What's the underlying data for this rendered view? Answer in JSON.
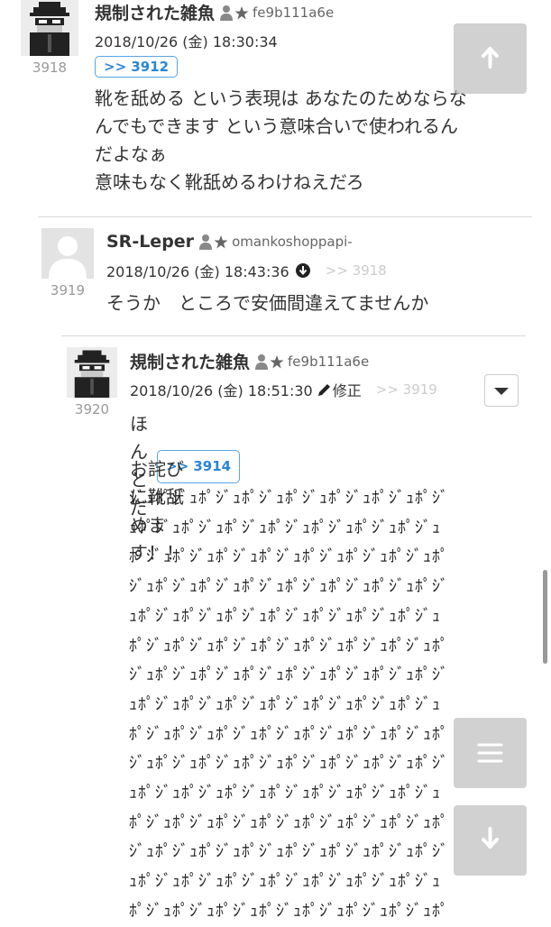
{
  "posts": [
    {
      "number": "3918",
      "name": "規制された雑魚",
      "uid": "fe9b111a6e",
      "date": "2018/10/26 (金) 18:30:34",
      "anchor": ">> 3912",
      "body": "靴を舐める という表現は あなたのためならな\nんでもできます という意味合いで使われるん\nだよなぁ\n意味もなく靴舐めるわけねえだろ"
    },
    {
      "number": "3919",
      "name": "SR-Leper",
      "uid": "omankoshoppapi-",
      "date": "2018/10/26 (金) 18:43:36",
      "reply_ref": ">> 3918",
      "body": "そうか　ところで安価間違えてませんか"
    },
    {
      "number": "3920",
      "name": "規制された雑魚",
      "uid": "fe9b111a6e",
      "date": "2018/10/26 (金) 18:51:30",
      "edited": "修正",
      "reply_ref": ">> 3919",
      "body_prefix": "ほんとだ",
      "anchor": ">> 3914",
      "body2": "お詫びに靴舐めます！！",
      "spam_lines": [
        "ｼﾞｭﾎﾟｼﾞｭﾎﾟｼﾞｭﾎﾟｼﾞｭﾎﾟｼﾞｭﾎﾟｼﾞｭﾎﾟｼﾞｭﾎﾟｼﾞ",
        "ｭﾎﾟｼﾞｭﾎﾟｼﾞｭﾎﾟｼﾞｭﾎﾟｼﾞｭﾎﾟｼﾞｭﾎﾟｼﾞｭﾎﾟｼﾞｭ",
        "ﾎﾟｼﾞｭﾎﾟｼﾞｭﾎﾟｼﾞｭﾎﾟｼﾞｭﾎﾟｼﾞｭﾎﾟｼﾞｭﾎﾟｼﾞｭﾎﾟ",
        "ｼﾞｭﾎﾟｼﾞｭﾎﾟｼﾞｭﾎﾟｼﾞｭﾎﾟｼﾞｭﾎﾟｼﾞｭﾎﾟｼﾞｭﾎﾟｼﾞ",
        "ｭﾎﾟｼﾞｭﾎﾟｼﾞｭﾎﾟｼﾞｭﾎﾟｼﾞｭﾎﾟｼﾞｭﾎﾟｼﾞｭﾎﾟｼﾞｭ",
        "ﾎﾟｼﾞｭﾎﾟｼﾞｭﾎﾟｼﾞｭﾎﾟｼﾞｭﾎﾟｼﾞｭﾎﾟｼﾞｭﾎﾟｼﾞｭﾎﾟ",
        "ｼﾞｭﾎﾟｼﾞｭﾎﾟｼﾞｭﾎﾟｼﾞｭﾎﾟｼﾞｭﾎﾟｼﾞｭﾎﾟｼﾞｭﾎﾟｼﾞ",
        "ｭﾎﾟｼﾞｭﾎﾟｼﾞｭﾎﾟｼﾞｭﾎﾟｼﾞｭﾎﾟｼﾞｭﾎﾟｼﾞｭﾎﾟｼﾞｭ",
        "ﾎﾟｼﾞｭﾎﾟｼﾞｭﾎﾟｼﾞｭﾎﾟｼﾞｭﾎﾟｼﾞｭﾎﾟｼﾞｭﾎﾟｼﾞｭﾎﾟ",
        "ｼﾞｭﾎﾟｼﾞｭﾎﾟｼﾞｭﾎﾟｼﾞｭﾎﾟｼﾞｭﾎﾟｼﾞｭﾎﾟｼﾞｭﾎﾟｼﾞ",
        "ｭﾎﾟｼﾞｭﾎﾟｼﾞｭﾎﾟｼﾞｭﾎﾟｼﾞｭﾎﾟｼﾞｭﾎﾟｼﾞｭﾎﾟｼﾞｭ",
        "ﾎﾟｼﾞｭﾎﾟｼﾞｭﾎﾟｼﾞｭﾎﾟｼﾞｭﾎﾟｼﾞｭﾎﾟｼﾞｭﾎﾟｼﾞｭﾎﾟ",
        "ｼﾞｭﾎﾟｼﾞｭﾎﾟｼﾞｭﾎﾟｼﾞｭﾎﾟｼﾞｭﾎﾟｼﾞｭﾎﾟｼﾞｭﾎﾟｼﾞ",
        "ｭﾎﾟｼﾞｭﾎﾟｼﾞｭﾎﾟｼﾞｭﾎﾟｼﾞｭﾎﾟｼﾞｭﾎﾟｼﾞｭﾎﾟｼﾞｭ",
        "ﾎﾟｼﾞｭﾎﾟｼﾞｭﾎﾟｼﾞｭﾎﾟｼﾞｭﾎﾟｼﾞｭﾎﾟｼﾞｭﾎﾟｼﾞｭﾎﾟ"
      ]
    }
  ],
  "icons": {
    "id_badge": "person-star-icon",
    "jump": "down-circle-icon",
    "edit": "pencil-icon",
    "dropdown": "caret-down-icon",
    "scroll_top": "arrow-up-icon",
    "menu": "hamburger-menu-icon",
    "scroll_bottom": "arrow-down-icon"
  },
  "colors": {
    "anchor": "#2a86d4",
    "ref_gray": "#cccccc",
    "fab": "#bebebe"
  }
}
